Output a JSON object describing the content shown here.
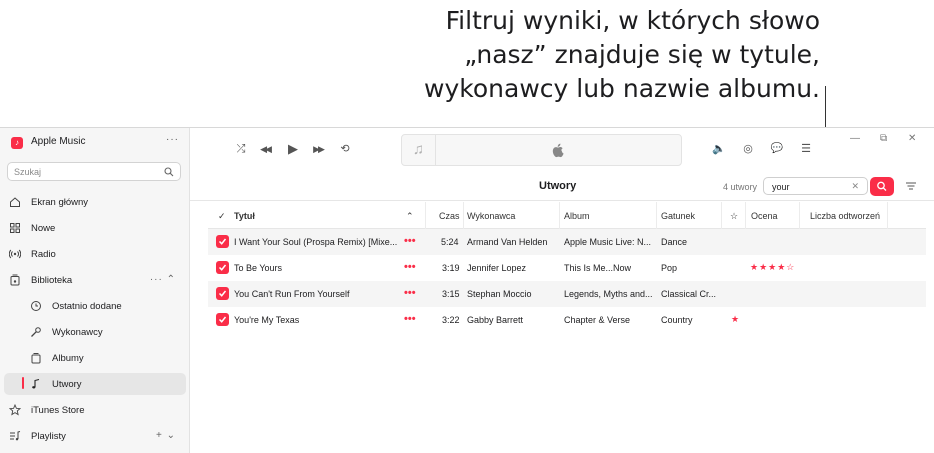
{
  "callout": {
    "lines": [
      "Filtruj wyniki, w których słowo",
      "„nasz” znajduje się w tytule,",
      "wykonawcy lub nazwie albumu."
    ]
  },
  "app": {
    "name": "Apple Music",
    "more": "···"
  },
  "sidebar": {
    "search_placeholder": "Szukaj",
    "items": [
      {
        "label": "Ekran główny",
        "icon": "house-icon"
      },
      {
        "label": "Nowe",
        "icon": "grid-icon"
      },
      {
        "label": "Radio",
        "icon": "radio-waves-icon"
      },
      {
        "label": "Biblioteka",
        "icon": "library-icon",
        "trail": "···  ⌃"
      },
      {
        "label": "Ostatnio dodane",
        "icon": "clock-icon"
      },
      {
        "label": "Wykonawcy",
        "icon": "microphone-icon"
      },
      {
        "label": "Albumy",
        "icon": "album-icon"
      },
      {
        "label": "Utwory",
        "icon": "music-note-icon",
        "active": true
      },
      {
        "label": "iTunes Store",
        "icon": "star-icon"
      },
      {
        "label": "Playlisty",
        "icon": "playlist-icon",
        "trail": "+  ⌄"
      }
    ]
  },
  "toolbar": {
    "shuffle": "⤮",
    "prev": "◀◀",
    "play": "▶",
    "next": "▶▶",
    "repeat": "⟲",
    "art_icon": "♫",
    "volume": "🔈",
    "airplay": "◎",
    "lyrics": "💬",
    "queue": "☰",
    "minimize": "—",
    "restore": "⧉",
    "close": "✕"
  },
  "content": {
    "title": "Utwory",
    "count": "4 utwory",
    "filter_value": "your",
    "filter_clear": "✕"
  },
  "table": {
    "columns": {
      "check": "✓",
      "title": "Tytuł",
      "sort": "⌃",
      "time": "Czas",
      "artist": "Wykonawca",
      "album": "Album",
      "genre": "Gatunek",
      "fav": "☆",
      "rating": "Ocena",
      "plays": "Liczba odtworzeń"
    },
    "rows": [
      {
        "title": "I Want Your Soul (Prospa Remix) [Mixe...",
        "more": "•••",
        "time": "5:24",
        "artist": "Armand Van Helden",
        "album": "Apple Music Live: N...",
        "genre": "Dance",
        "fav": "",
        "rating": ""
      },
      {
        "title": "To Be Yours",
        "more": "•••",
        "time": "3:19",
        "artist": "Jennifer Lopez",
        "album": "This Is Me...Now",
        "genre": "Pop",
        "fav": "",
        "rating": "★★★★☆"
      },
      {
        "title": "You Can't Run From Yourself",
        "more": "•••",
        "time": "3:15",
        "artist": "Stephan Moccio",
        "album": "Legends, Myths and...",
        "genre": "Classical Cr...",
        "fav": "",
        "rating": ""
      },
      {
        "title": "You're My Texas",
        "more": "•••",
        "time": "3:22",
        "artist": "Gabby Barrett",
        "album": "Chapter & Verse",
        "genre": "Country",
        "fav": "★",
        "rating": ""
      }
    ]
  },
  "colors": {
    "accent": "#fa2d48",
    "sidebar_bg": "#f6f6f6",
    "row_alt": "#f5f5f5"
  }
}
